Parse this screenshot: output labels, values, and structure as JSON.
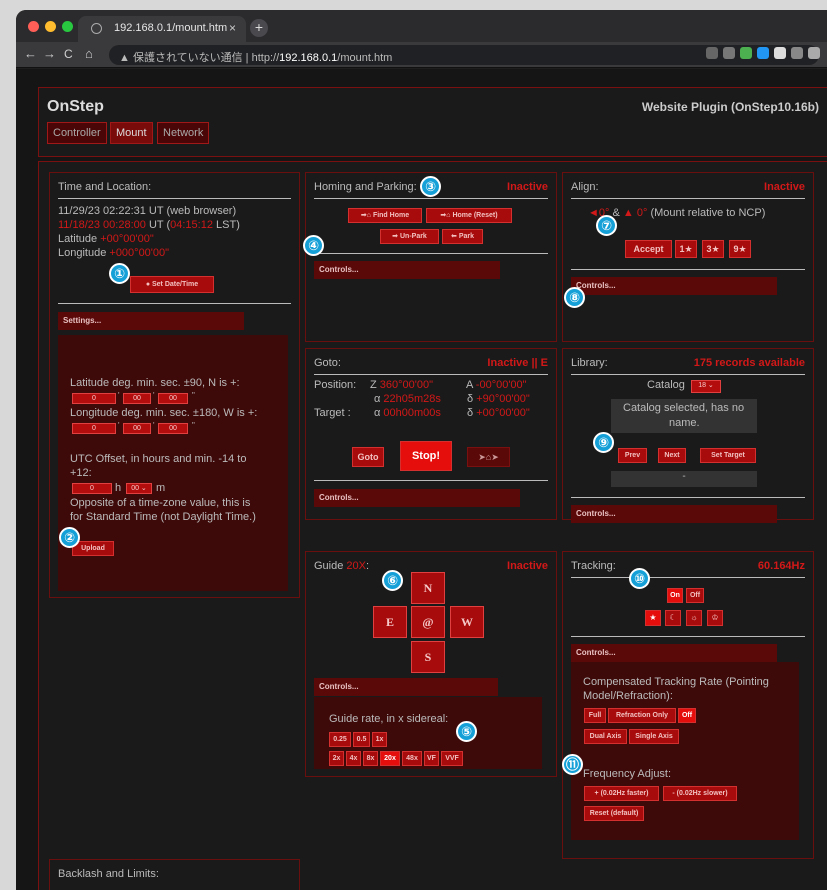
{
  "browser": {
    "tab_title": "192.168.0.1/mount.htm",
    "close": "×",
    "new_tab": "+",
    "back": "←",
    "forward": "→",
    "reload": "C",
    "home": "⌂",
    "warn_icon": "▲",
    "security": "保護されていない通信",
    "url_prefix": "http://",
    "url_host": "192.168.0.1",
    "url_path": "/mount.htm"
  },
  "header": {
    "brand": "OnStep",
    "plugin": "Website Plugin (OnStep10.16b)",
    "nav": [
      "Controller",
      "Mount",
      "Network"
    ]
  },
  "time": {
    "title": "Time and Location:",
    "utc": "11/29/23 02:22:31 UT (web browser)",
    "local_date": "11/18/23 00:28:00",
    "ut_label": " UT (",
    "lst": "04:15:12",
    "lst_label": " LST)",
    "lat_label": "Latitude ",
    "lat": "+00°00'00\"",
    "lon_label": "Longitude ",
    "lon": "+000°00'00\"",
    "set_btn": "Set Date/Time",
    "settings_bar": "Settings...",
    "lat_hint": "Latitude deg. min. sec. ±90, N is +:",
    "lat_vals": [
      "0",
      "00",
      "00"
    ],
    "lon_hint": "Longitude deg. min. sec. ±180, W is +:",
    "lon_vals": [
      "0",
      "00",
      "00"
    ],
    "utc_hint1": "UTC Offset, in hours and min. -14 to",
    "utc_hint2": "+12:",
    "utc_h": "0",
    "utc_h_label": "h",
    "utc_m": "00",
    "utc_m_label": "m",
    "tz_note1": "Opposite of a time-zone value, this is",
    "tz_note2": "for Standard Time (not Daylight Time.)",
    "upload": "Upload"
  },
  "homing": {
    "title": "Homing and Parking:",
    "status": "Inactive",
    "find_home": "Find Home",
    "home_reset": "Home (Reset)",
    "unpark": "Un-Park",
    "park": "Park",
    "controls": "Controls..."
  },
  "align": {
    "title": "Align:",
    "status": "Inactive",
    "left_val": "0°",
    "amp": "&",
    "up_val": "0°",
    "note": "(Mount relative to NCP)",
    "accept": "Accept",
    "one": "1★",
    "three": "3★",
    "nine": "9★",
    "controls": "Controls..."
  },
  "goto": {
    "title": "Goto:",
    "status": "Inactive || E",
    "pos_label": "Position:",
    "z": "Z",
    "z_val": "360°00'00\"",
    "a": "A",
    "a_val": "-00°00'00\"",
    "alpha": "α",
    "pos_ra": "22h05m28s",
    "delta": "δ",
    "pos_dec": "+90°00'00\"",
    "tgt_label": "Target :",
    "tgt_ra": "00h00m00s",
    "tgt_dec": "+00°00'00\"",
    "goto_btn": "Goto",
    "stop_btn": "Stop!",
    "home_arrow": "➤⌂➤",
    "controls": "Controls..."
  },
  "library": {
    "title": "Library:",
    "status": "175 records available",
    "catalog_label": "Catalog",
    "catalog_val": "18",
    "catalog_msg1": "Catalog selected, has no",
    "catalog_msg2": "name.",
    "prev": "Prev",
    "next": "Next",
    "set_target": "Set Target",
    "target_display": "-",
    "controls": "Controls..."
  },
  "guide": {
    "title": "Guide",
    "rate": "20X",
    "title_colon": ":",
    "status": "Inactive",
    "n": "N",
    "e": "E",
    "sync": "@",
    "w": "W",
    "s": "S",
    "controls": "Controls...",
    "rate_label": "Guide rate, in x sidereal:",
    "rates_row1": [
      "0.25",
      "0.5",
      "1x"
    ],
    "rates_row2": [
      "2x",
      "4x",
      "8x",
      "20x",
      "48x",
      "VF",
      "VVF"
    ]
  },
  "tracking": {
    "title": "Tracking:",
    "status": "60.164Hz",
    "on": "On",
    "off": "Off",
    "modes": [
      "★",
      "☾",
      "☼",
      "♔"
    ],
    "controls": "Controls...",
    "comp1": "Compensated Tracking Rate (Pointing",
    "comp2": "Model/Refraction):",
    "full": "Full",
    "refr": "Refraction Only",
    "comp_off": "Off",
    "dual": "Dual Axis",
    "single": "Single Axis",
    "freq": "Frequency Adjust:",
    "faster": "+ (0.02Hz faster)",
    "slower": "- (0.02Hz slower)",
    "reset": "Reset (default)"
  },
  "backlash": {
    "title": "Backlash and Limits:"
  },
  "badges": [
    "①",
    "②",
    "③",
    "④",
    "⑤",
    "⑥",
    "⑦",
    "⑧",
    "⑨",
    "⑩",
    "⑪"
  ],
  "colors": {
    "accent": "#d21818",
    "button": "#a80b0b",
    "badge": "#16a0d8"
  }
}
